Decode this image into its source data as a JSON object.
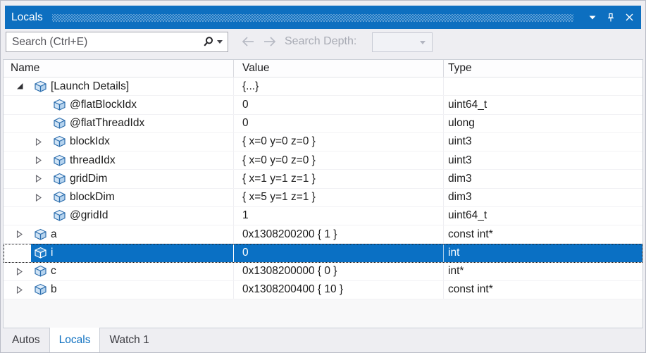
{
  "titlebar": {
    "title": "Locals",
    "icons": [
      "window-position-icon",
      "pin-icon",
      "close-icon"
    ]
  },
  "toolbar": {
    "search_placeholder": "Search (Ctrl+E)",
    "search_depth_label": "Search Depth:",
    "search_depth_value": ""
  },
  "grid": {
    "columns": [
      {
        "label": "Name"
      },
      {
        "label": "Value"
      },
      {
        "label": "Type"
      }
    ],
    "rows": [
      {
        "name": "[Launch Details]",
        "value": "{...}",
        "type": "",
        "level": 0,
        "expander": "expanded",
        "selected": false
      },
      {
        "name": "@flatBlockIdx",
        "value": "0",
        "type": "uint64_t",
        "level": 1,
        "expander": "none",
        "selected": false
      },
      {
        "name": "@flatThreadIdx",
        "value": "0",
        "type": "ulong",
        "level": 1,
        "expander": "none",
        "selected": false
      },
      {
        "name": "blockIdx",
        "value": "{ x=0 y=0 z=0 }",
        "type": "uint3",
        "level": 1,
        "expander": "collapsed",
        "selected": false
      },
      {
        "name": "threadIdx",
        "value": "{ x=0 y=0 z=0 }",
        "type": "uint3",
        "level": 1,
        "expander": "collapsed",
        "selected": false
      },
      {
        "name": "gridDim",
        "value": "{ x=1 y=1 z=1 }",
        "type": "dim3",
        "level": 1,
        "expander": "collapsed",
        "selected": false
      },
      {
        "name": "blockDim",
        "value": "{ x=5 y=1 z=1 }",
        "type": "dim3",
        "level": 1,
        "expander": "collapsed",
        "selected": false
      },
      {
        "name": "@gridId",
        "value": "1",
        "type": "uint64_t",
        "level": 1,
        "expander": "none",
        "selected": false
      },
      {
        "name": "a",
        "value": "0x1308200200 { 1 }",
        "type": "const int*",
        "level": 0,
        "expander": "collapsed",
        "selected": false
      },
      {
        "name": "i",
        "value": "0",
        "type": "int",
        "level": 0,
        "expander": "none",
        "selected": true
      },
      {
        "name": "c",
        "value": "0x1308200000 { 0 }",
        "type": "int*",
        "level": 0,
        "expander": "collapsed",
        "selected": false
      },
      {
        "name": "b",
        "value": "0x1308200400 { 10 }",
        "type": "const int*",
        "level": 0,
        "expander": "collapsed",
        "selected": false
      }
    ]
  },
  "tabs": [
    {
      "label": "Autos",
      "active": false
    },
    {
      "label": "Locals",
      "active": true
    },
    {
      "label": "Watch 1",
      "active": false
    }
  ],
  "colors": {
    "titlebar": "#0d6fc0",
    "selection": "#0a70c4",
    "panel": "#eeeef2",
    "window_border": "#b9bcc6",
    "grid_border": "#ccd0d8",
    "text": "#1c1c1c",
    "gray_text": "#a7aab3",
    "tab_text": "#39393f",
    "active_tab_text": "#0c6fc0",
    "search_border": "#a5a7b0"
  }
}
